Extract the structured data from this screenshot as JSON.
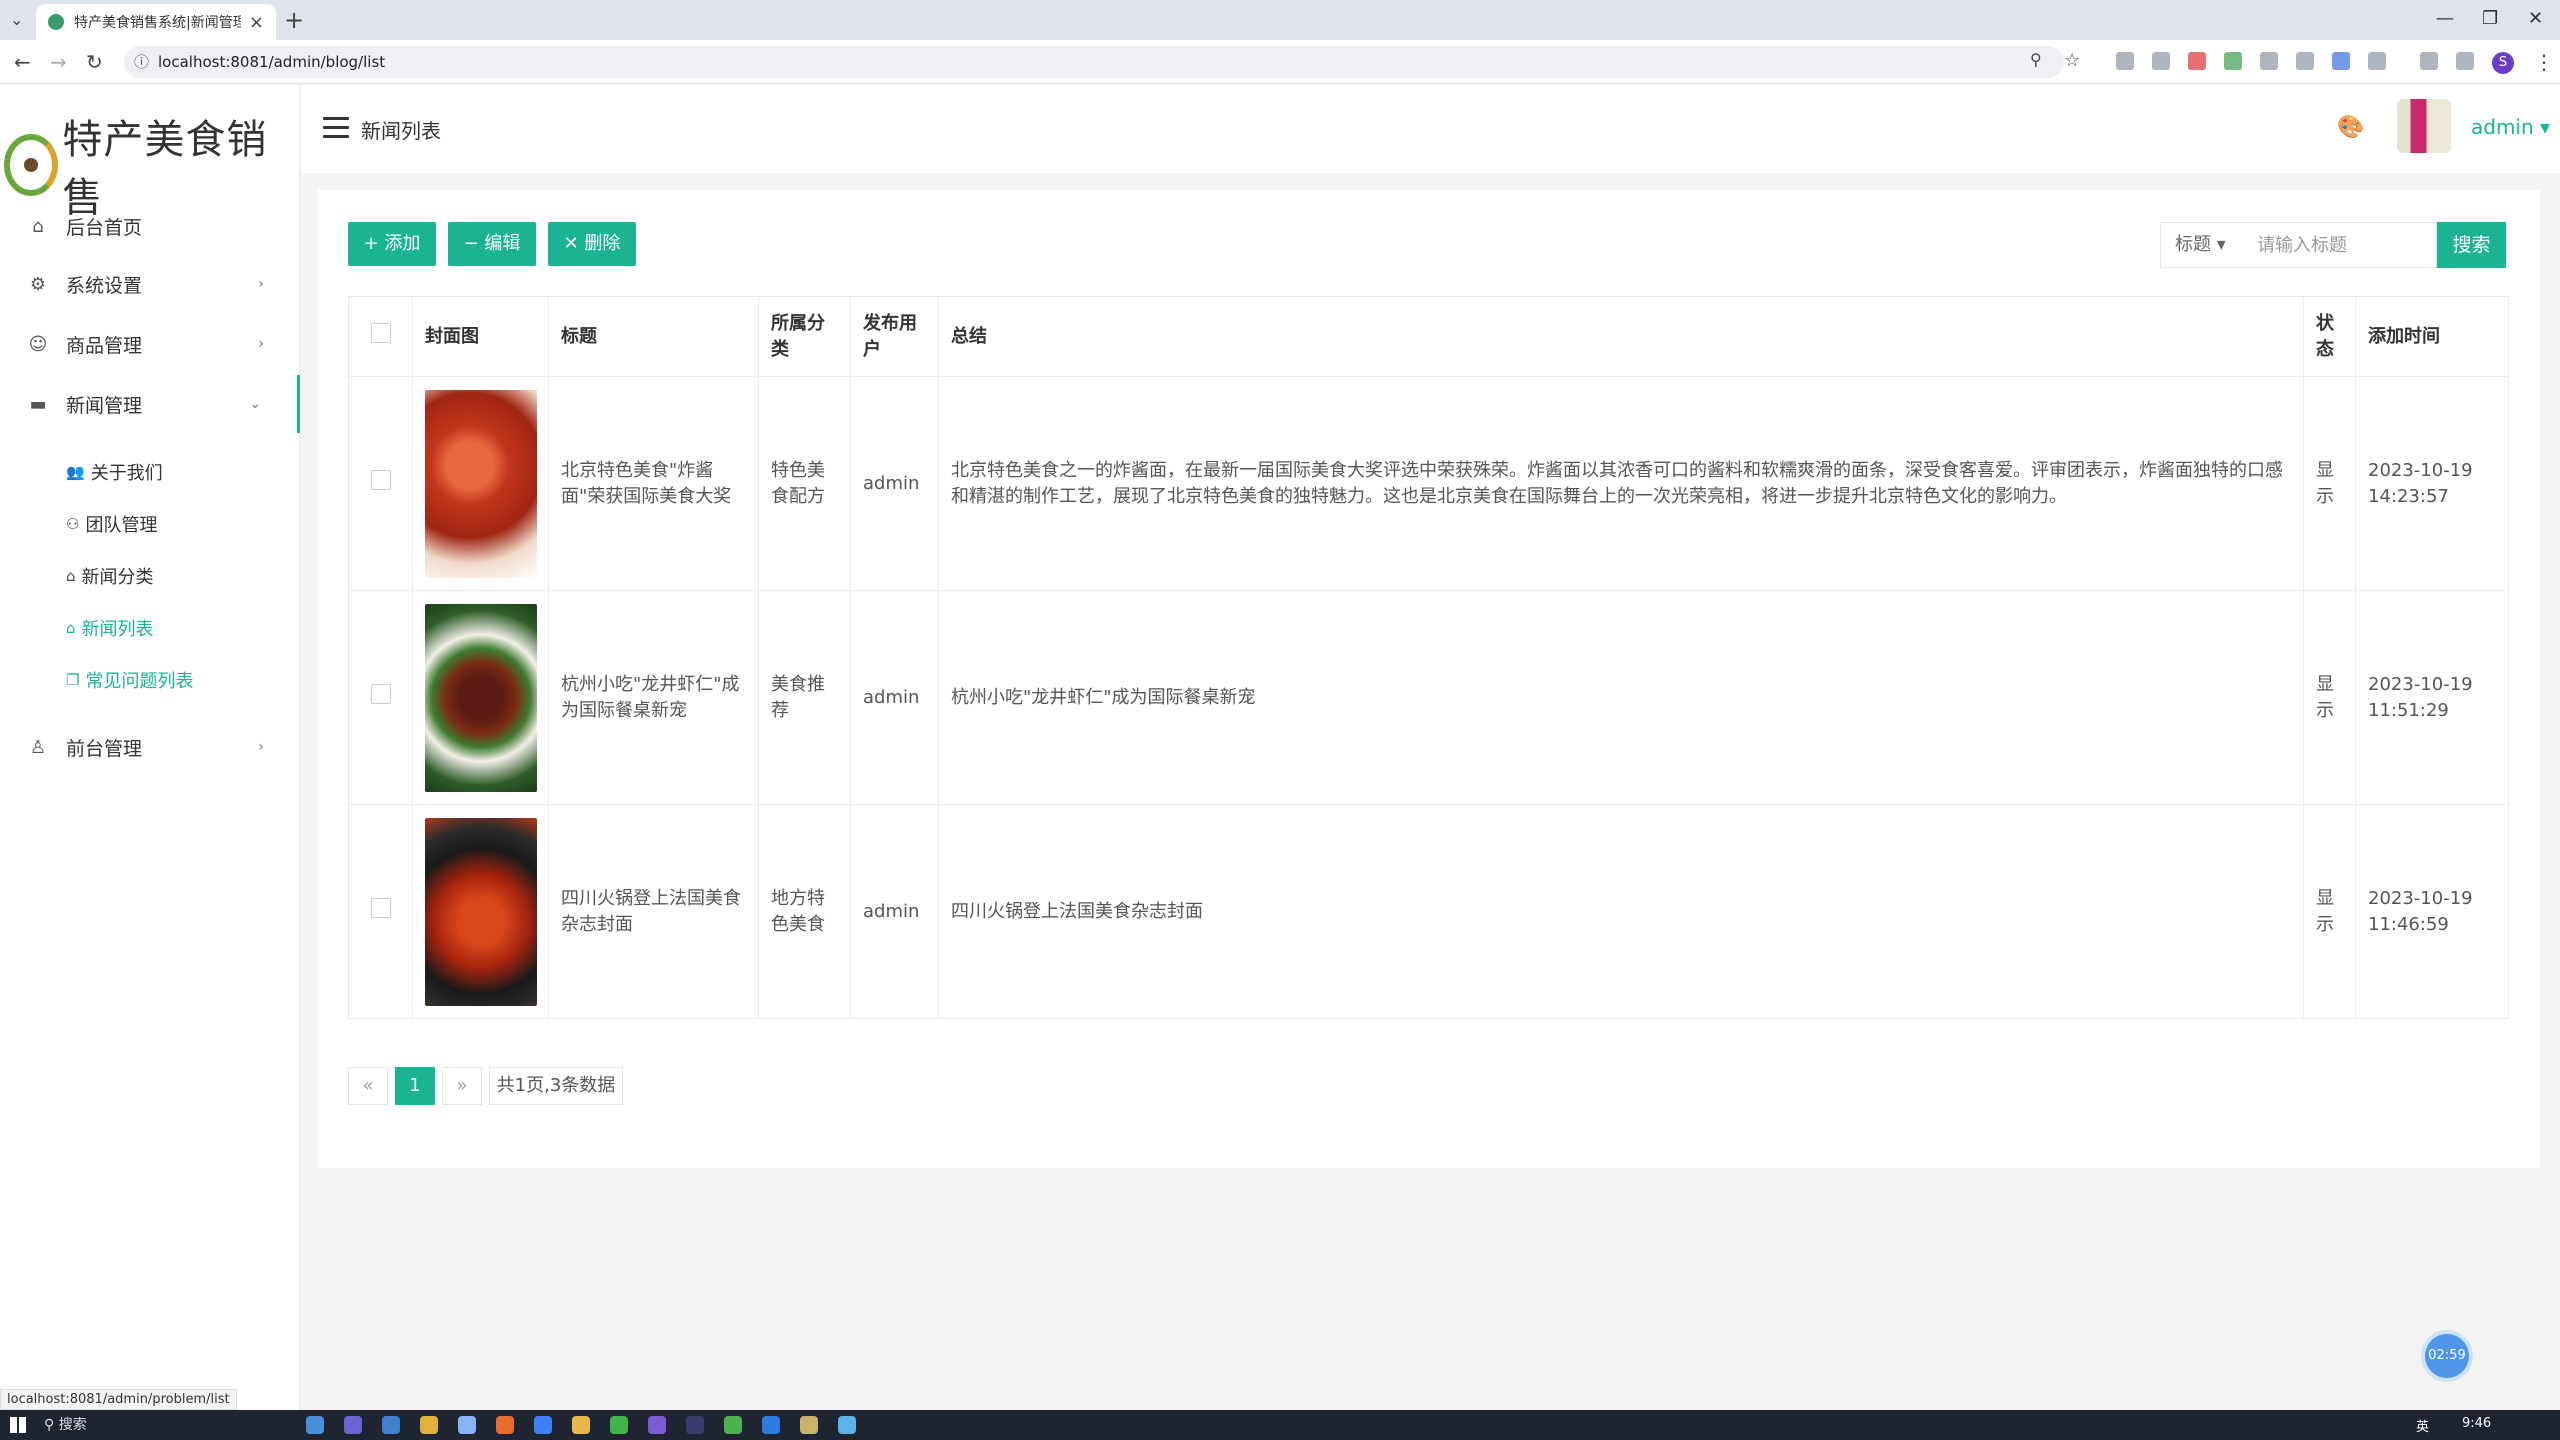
{
  "browser": {
    "tab_title": "特产美食销售系统|新闻管理-新",
    "url": "localhost:8081/admin/blog/list",
    "status_url": "localhost:8081/admin/problem/list"
  },
  "logo_text": "特产美食销售",
  "sidebar": {
    "items": [
      {
        "label": "后台首页"
      },
      {
        "label": "系统设置"
      },
      {
        "label": "商品管理"
      },
      {
        "label": "新闻管理"
      },
      {
        "label": "前台管理"
      }
    ],
    "sub_items": [
      {
        "label": "关于我们"
      },
      {
        "label": "团队管理"
      },
      {
        "label": "新闻分类"
      },
      {
        "label": "新闻列表"
      },
      {
        "label": "常见问题列表"
      }
    ]
  },
  "header": {
    "title": "新闻列表",
    "user": "admin ▾"
  },
  "toolbar": {
    "add": "+ 添加",
    "edit": "− 编辑",
    "delete": "✕ 删除",
    "search_field": "标题 ▾",
    "search_placeholder": "请输入标题",
    "search_button": "搜索"
  },
  "table": {
    "headers": [
      "封面图",
      "标题",
      "所属分类",
      "发布用户",
      "总结",
      "状态",
      "添加时间"
    ],
    "rows": [
      {
        "title": "北京特色美食\"炸酱面\"荣获国际美食大奖",
        "category": "特色美食配方",
        "user": "admin",
        "summary": "北京特色美食之一的炸酱面，在最新一届国际美食大奖评选中荣获殊荣。炸酱面以其浓香可口的酱料和软糯爽滑的面条，深受食客喜爱。评审团表示，炸酱面独特的口感和精湛的制作工艺，展现了北京特色美食的独特魅力。这也是北京美食在国际舞台上的一次光荣亮相，将进一步提升北京特色文化的影响力。",
        "status": "显示",
        "time": "2023-10-19 14:23:57"
      },
      {
        "title": "杭州小吃\"龙井虾仁\"成为国际餐桌新宠",
        "category": "美食推荐",
        "user": "admin",
        "summary": "杭州小吃\"龙井虾仁\"成为国际餐桌新宠",
        "status": "显示",
        "time": "2023-10-19 11:51:29"
      },
      {
        "title": "四川火锅登上法国美食杂志封面",
        "category": "地方特色美食",
        "user": "admin",
        "summary": "四川火锅登上法国美食杂志封面",
        "status": "显示",
        "time": "2023-10-19 11:46:59"
      }
    ]
  },
  "pagination": {
    "prev": "«",
    "current": "1",
    "next": "»",
    "info": "共1页,3条数据"
  },
  "timer": "02:59",
  "taskbar": {
    "search": "搜索",
    "lang": "英",
    "clock": "9:46"
  },
  "colors": {
    "accent": "#1ab394"
  }
}
